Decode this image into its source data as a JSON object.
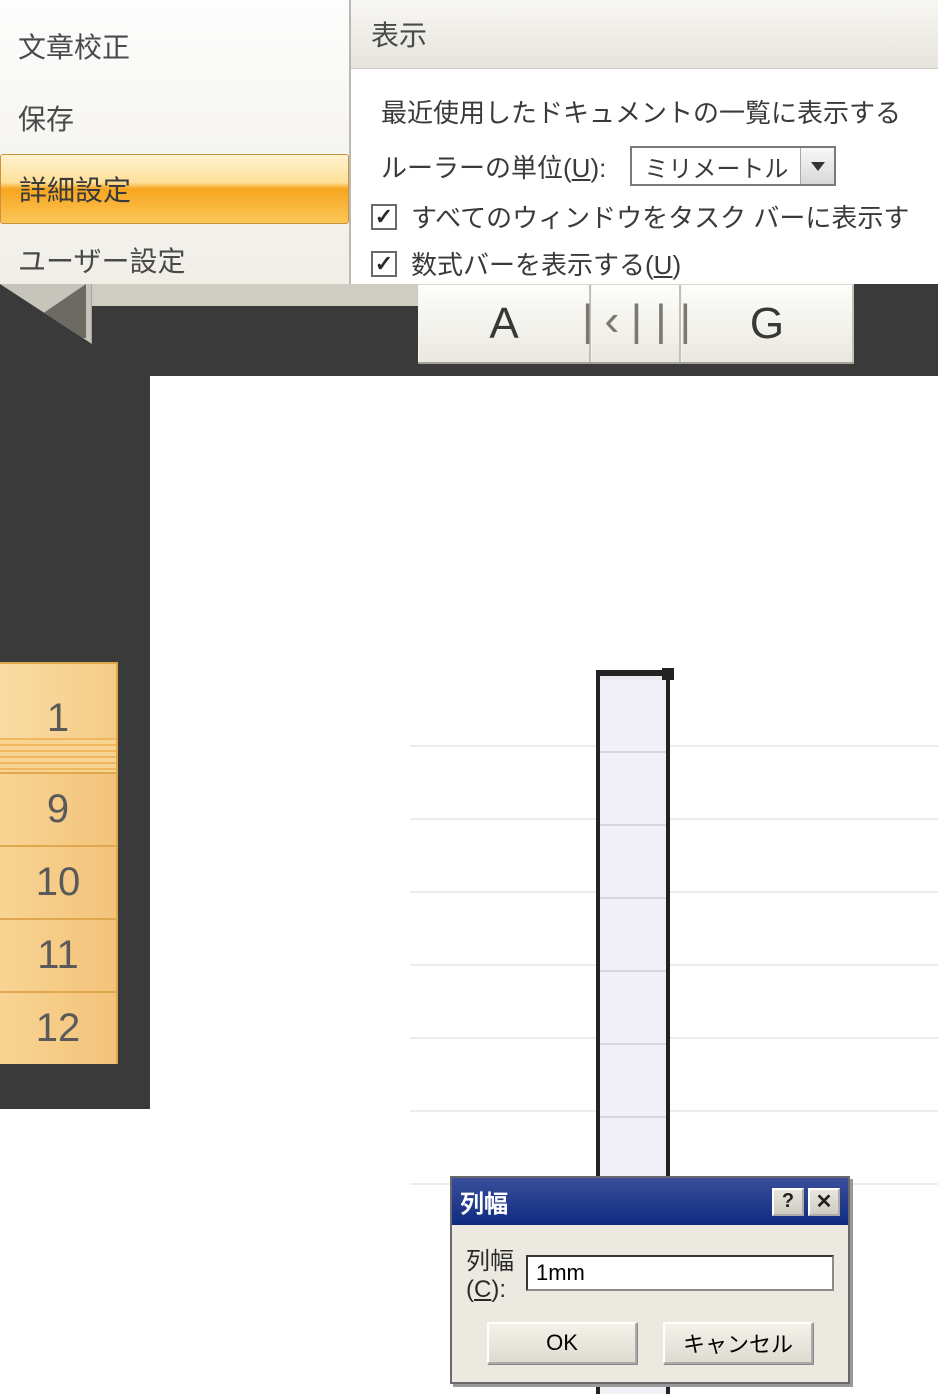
{
  "sidebar": {
    "items": [
      {
        "label": "文章校正"
      },
      {
        "label": "保存"
      },
      {
        "label": "詳細設定"
      },
      {
        "label": "ユーザー設定"
      }
    ],
    "selected_index": 2
  },
  "display_section": {
    "header": "表示",
    "recent_docs_label": "最近使用したドキュメントの一覧に表示する",
    "ruler_unit_label_pre": "ルーラーの単位(",
    "ruler_unit_key": "U",
    "ruler_unit_label_post": "):",
    "ruler_unit_value": "ミリメートル",
    "checkbox_taskbar": "すべてのウィンドウをタスク バーに表示す",
    "checkbox_formula_pre": "数式バーを表示する(",
    "checkbox_formula_key": "U",
    "checkbox_formula_post": ")"
  },
  "columns": [
    "A",
    "",
    "G"
  ],
  "column_drag_glyph": "|‹|||",
  "rows": [
    "1",
    "9",
    "10",
    "11",
    "12"
  ],
  "dialog": {
    "title": "列幅",
    "field_label_pre": "列幅(",
    "field_key": "C",
    "field_label_post": "):",
    "field_value": "1mm",
    "ok_label": "OK",
    "cancel_label": "キャンセル",
    "help_glyph": "?",
    "close_glyph": "✕"
  }
}
